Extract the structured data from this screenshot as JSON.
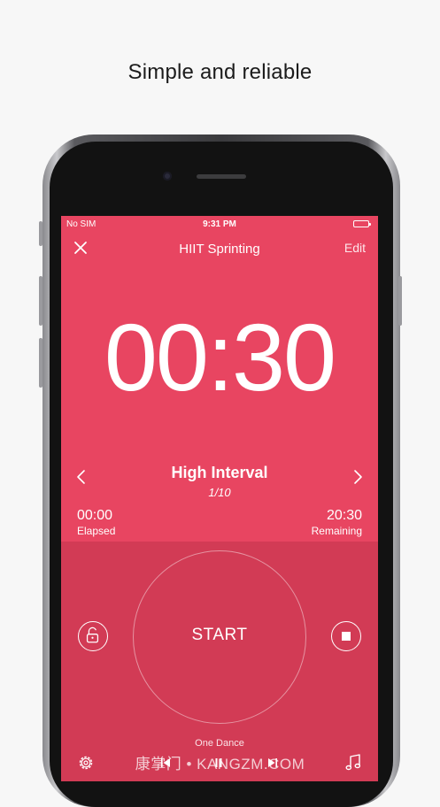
{
  "headline": "Simple and reliable",
  "status_bar": {
    "carrier": "No SIM",
    "time": "9:31 PM"
  },
  "navbar": {
    "title": "HIIT Sprinting",
    "edit_label": "Edit"
  },
  "timer": {
    "display": "00:30"
  },
  "interval": {
    "name": "High Interval",
    "count": "1/10"
  },
  "elapsed": {
    "value": "00:00",
    "label": "Elapsed"
  },
  "remaining": {
    "value": "20:30",
    "label": "Remaining"
  },
  "controls": {
    "start_label": "START"
  },
  "music": {
    "song_title": "One Dance"
  },
  "watermark": "康掌门 • KANGZM.COM",
  "colors": {
    "screen_bg": "#e84561",
    "controls_bg": "#d23b55",
    "accent_text": "#ffffff"
  },
  "icons": [
    "close-icon",
    "chevron-left-icon",
    "chevron-right-icon",
    "unlock-icon",
    "stop-icon",
    "gear-icon",
    "previous-icon",
    "pause-icon",
    "next-icon",
    "music-note-icon",
    "battery-icon"
  ]
}
